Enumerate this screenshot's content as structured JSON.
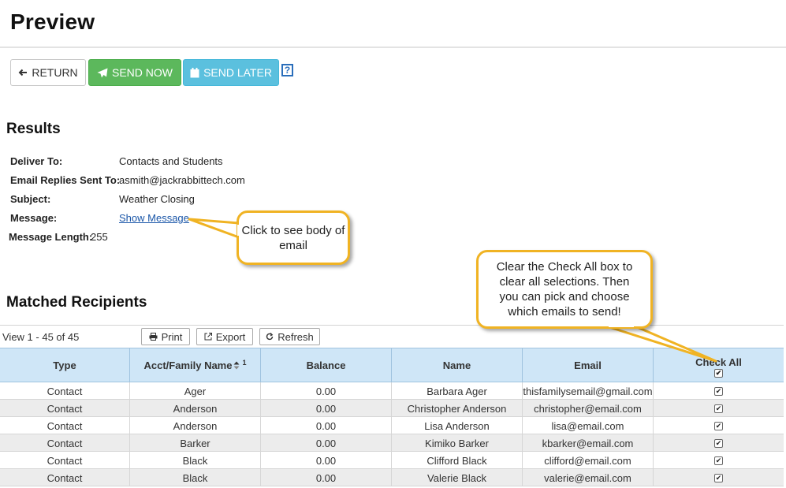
{
  "page": {
    "title": "Preview"
  },
  "actions": {
    "return_label": "RETURN",
    "send_now_label": "SEND NOW",
    "send_later_label": "SEND LATER",
    "help_label": "?"
  },
  "results": {
    "heading": "Results",
    "fields": [
      {
        "label": "Deliver To:",
        "value": "Contacts and Students"
      },
      {
        "label": "Email Replies Sent To:",
        "value": "asmith@jackrabbittech.com"
      },
      {
        "label": "Subject:",
        "value": "Weather Closing"
      },
      {
        "label": "Message:",
        "value": "Show Message"
      },
      {
        "label": "Message Length:",
        "value": "255"
      }
    ]
  },
  "callouts": {
    "show_message": "Click to see body of email",
    "check_all": "Clear the Check All box to clear all selections. Then you can pick and choose which emails to send!"
  },
  "matched": {
    "heading": "Matched Recipients",
    "view_count": "View 1 - 45 of 45",
    "toolbar": {
      "print_label": "Print",
      "export_label": "Export",
      "refresh_label": "Refresh"
    },
    "columns": {
      "type": "Type",
      "family": "Acct/Family Name",
      "sort_index": "1",
      "balance": "Balance",
      "name": "Name",
      "email": "Email",
      "check_all": "Check All"
    },
    "rows": [
      {
        "type": "Contact",
        "family": "Ager",
        "balance": "0.00",
        "name": "Barbara Ager",
        "email": "thisfamilysemail@gmail.com",
        "checked": true
      },
      {
        "type": "Contact",
        "family": "Anderson",
        "balance": "0.00",
        "name": "Christopher Anderson",
        "email": "christopher@email.com",
        "checked": true
      },
      {
        "type": "Contact",
        "family": "Anderson",
        "balance": "0.00",
        "name": "Lisa Anderson",
        "email": "lisa@email.com",
        "checked": true
      },
      {
        "type": "Contact",
        "family": "Barker",
        "balance": "0.00",
        "name": "Kimiko Barker",
        "email": "kbarker@email.com",
        "checked": true
      },
      {
        "type": "Contact",
        "family": "Black",
        "balance": "0.00",
        "name": "Clifford Black",
        "email": "clifford@email.com",
        "checked": true
      },
      {
        "type": "Contact",
        "family": "Black",
        "balance": "0.00",
        "name": "Valerie Black",
        "email": "valerie@email.com",
        "checked": true
      }
    ]
  },
  "colors": {
    "send_now": "#5cb85c",
    "send_later": "#5bc0de",
    "grid_header": "#cfe6f7",
    "callout_border": "#f0b323",
    "link": "#1a56a8"
  }
}
